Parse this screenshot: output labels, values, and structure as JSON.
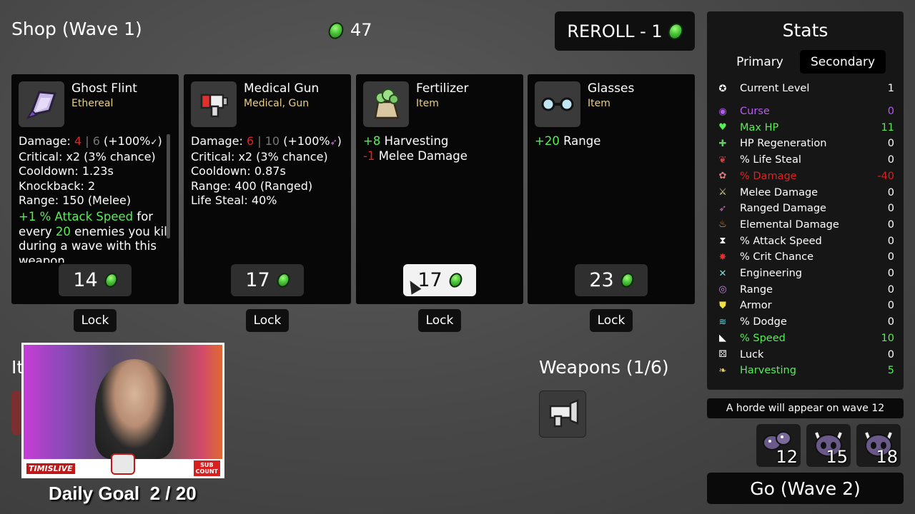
{
  "shop": {
    "title": "Shop (Wave 1)",
    "money": "47",
    "reroll_label": "REROLL - 1"
  },
  "cards": [
    {
      "name": "Ghost Flint",
      "subtitle": "Ethereal",
      "price": "14",
      "lock": "Lock",
      "icon": "ghost-flint-icon",
      "stats": {
        "damage_label": "Damage: ",
        "damage_main": "4",
        "damage_sep": " | ",
        "damage_alt": "6",
        "damage_tail": " (+100%",
        "critical": "Critical: x2 (3% chance)",
        "cooldown": "Cooldown: 1.23s",
        "knockback": "Knockback: 2",
        "range": "Range: 150 (Melee)",
        "effect_green": "+1 % Attack Speed",
        "effect_a": " for every ",
        "effect_num": "20",
        "effect_b": " enemies you kill during a wave with this weapon"
      }
    },
    {
      "name": "Medical Gun",
      "subtitle": "Medical, Gun",
      "price": "17",
      "lock": "Lock",
      "icon": "medical-gun-icon",
      "stats": {
        "damage_label": "Damage: ",
        "damage_main": "6",
        "damage_sep": " | ",
        "damage_alt": "10",
        "damage_tail": " (+100%",
        "critical": "Critical: x2 (3% chance)",
        "cooldown": "Cooldown: 0.87s",
        "range": "Range: 400 (Ranged)",
        "life_steal": "Life Steal: 40%"
      }
    },
    {
      "name": "Fertilizer",
      "subtitle": "Item",
      "price": "17",
      "lock": "Lock",
      "icon": "fertilizer-icon",
      "stats": {
        "l1_val": "+8",
        "l1_txt": " Harvesting",
        "l2_val": "-1",
        "l2_txt": " Melee Damage"
      }
    },
    {
      "name": "Glasses",
      "subtitle": "Item",
      "price": "23",
      "lock": "Lock",
      "icon": "glasses-icon",
      "stats": {
        "l1_val": "+20",
        "l1_txt": " Range"
      }
    }
  ],
  "stats_panel": {
    "title": "Stats",
    "tab_primary": "Primary",
    "tab_secondary": "Secondary",
    "active_tab": "Secondary",
    "rows": [
      {
        "label": "Current Level",
        "value": "1",
        "color": "#ffffff",
        "icon": "level-icon"
      },
      {
        "label": "Curse",
        "value": "0",
        "color": "#b55cf0",
        "icon": "curse-icon"
      },
      {
        "label": "Max HP",
        "value": "11",
        "color": "#55ee55",
        "icon": "heart-icon"
      },
      {
        "label": "HP Regeneration",
        "value": "0",
        "color": "#ffffff",
        "icon": "regen-icon"
      },
      {
        "label": "% Life Steal",
        "value": "0",
        "color": "#ffffff",
        "icon": "life-steal-icon"
      },
      {
        "label": "% Damage",
        "value": "-40",
        "color": "#e02020",
        "icon": "brain-icon"
      },
      {
        "label": "Melee Damage",
        "value": "0",
        "color": "#ffffff",
        "icon": "sword-icon"
      },
      {
        "label": "Ranged Damage",
        "value": "0",
        "color": "#ffffff",
        "icon": "bow-icon"
      },
      {
        "label": "Elemental Damage",
        "value": "0",
        "color": "#ffffff",
        "icon": "flame-icon"
      },
      {
        "label": "% Attack Speed",
        "value": "0",
        "color": "#ffffff",
        "icon": "hourglass-icon"
      },
      {
        "label": "% Crit Chance",
        "value": "0",
        "color": "#ffffff",
        "icon": "crit-icon"
      },
      {
        "label": "Engineering",
        "value": "0",
        "color": "#ffffff",
        "icon": "wrench-icon"
      },
      {
        "label": "Range",
        "value": "0",
        "color": "#ffffff",
        "icon": "range-icon"
      },
      {
        "label": "Armor",
        "value": "0",
        "color": "#ffffff",
        "icon": "shield-icon"
      },
      {
        "label": "% Dodge",
        "value": "0",
        "color": "#ffffff",
        "icon": "dodge-icon"
      },
      {
        "label": "% Speed",
        "value": "10",
        "color": "#55ee55",
        "icon": "boot-icon"
      },
      {
        "label": "Luck",
        "value": "0",
        "color": "#ffffff",
        "icon": "dice-icon"
      },
      {
        "label": "Harvesting",
        "value": "5",
        "color": "#55ee55",
        "icon": "wheat-icon"
      }
    ]
  },
  "horde_text": "A horde will appear on wave 12",
  "enemies": [
    {
      "count": "12",
      "icon": "bug-enemy-icon"
    },
    {
      "count": "15",
      "icon": "horned-enemy-icon"
    },
    {
      "count": "18",
      "icon": "horned-enemy-icon"
    }
  ],
  "go_label": "Go (Wave 2)",
  "weapons_title": "Weapons (1/6)",
  "items_title": "It",
  "webcam": {
    "brand": "TIMISLIVE",
    "sub_line1": "SUB",
    "sub_line2": "COUNT"
  },
  "daily_goal": "Daily Goal  2 / 20"
}
